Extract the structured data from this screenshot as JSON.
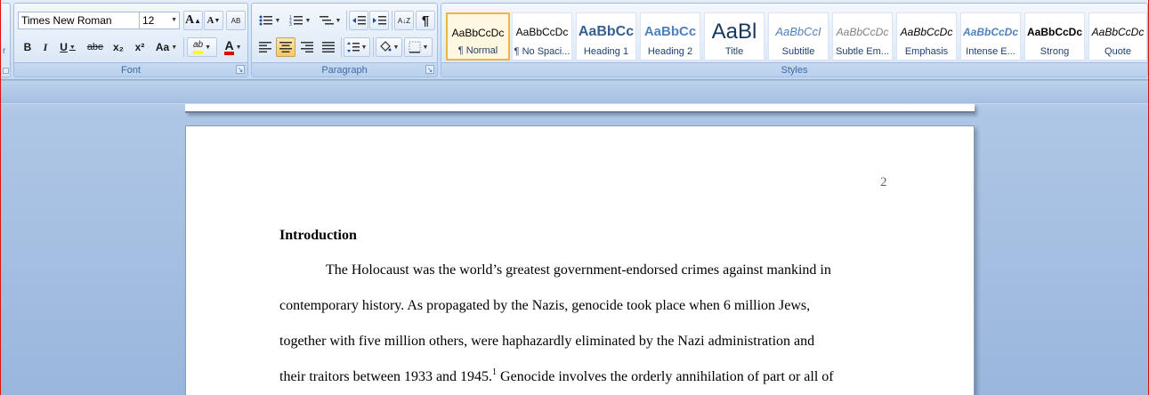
{
  "ribbon": {
    "left_edge_label": "r",
    "font": {
      "group_label": "Font",
      "font_name": "Times New Roman",
      "font_size": "12",
      "bold": "B",
      "italic": "I",
      "underline": "U",
      "strikethrough": "abe",
      "subscript": "x₂",
      "superscript": "x²",
      "change_case": "Aa",
      "highlight": "ab",
      "font_color": "A",
      "grow": "A",
      "shrink": "A",
      "clear_format": "AB"
    },
    "paragraph": {
      "group_label": "Paragraph",
      "pilcrow": "¶",
      "sort": "A↓Z"
    },
    "styles": {
      "group_label": "Styles",
      "items": [
        {
          "preview": "AaBbCcDc",
          "name": "¶ Normal"
        },
        {
          "preview": "AaBbCcDc",
          "name": "¶ No Spaci..."
        },
        {
          "preview": "AaBbCc",
          "name": "Heading 1"
        },
        {
          "preview": "AaBbCc",
          "name": "Heading 2"
        },
        {
          "preview": "AaBl",
          "name": "Title"
        },
        {
          "preview": "AaBbCcI",
          "name": "Subtitle"
        },
        {
          "preview": "AaBbCcDc",
          "name": "Subtle Em..."
        },
        {
          "preview": "AaBbCcDc",
          "name": "Emphasis"
        },
        {
          "preview": "AaBbCcDc",
          "name": "Intense E..."
        },
        {
          "preview": "AaBbCcDc",
          "name": "Strong"
        },
        {
          "preview": "AaBbCcDc",
          "name": "Quote"
        }
      ]
    }
  },
  "document": {
    "page_number": "2",
    "heading": "Introduction",
    "lines": [
      "The Holocaust was the world’s greatest government-endorsed crimes against mankind in",
      "contemporary history. As propagated by the Nazis, genocide took place when 6 million Jews,",
      "together with five million others, were haphazardly eliminated by the Nazi administration and"
    ],
    "last_line_before": "their traitors between 1933 and 1945.",
    "footnote_ref": "1",
    "last_line_after": " Genocide involves the orderly annihilation of part or all of"
  },
  "colors": {
    "selected_style_border": "#f0b444",
    "heading1_blue": "#365f91",
    "font_color_red": "#e00000",
    "highlight_yellow": "#ffff00"
  }
}
